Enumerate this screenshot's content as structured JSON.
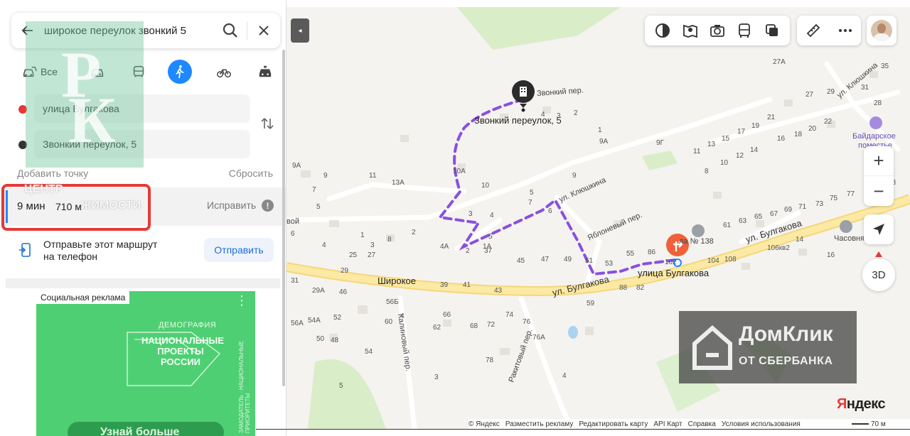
{
  "search": {
    "query": "широкое переулок звонкий 5"
  },
  "modes": {
    "all_label": "Все",
    "active": "walk"
  },
  "route_points": {
    "from": "улица Булгакова",
    "to": "Звонкий переулок, 5",
    "add_point": "Добавить точку",
    "reset": "Сбросить"
  },
  "route": {
    "time": "9 мин",
    "distance": "710 м",
    "fix": "Исправить"
  },
  "send": {
    "text_line1": "Отправьте этот маршрут",
    "text_line2": "на телефон",
    "button": "Отправить"
  },
  "ad": {
    "label": "Социальная реклама",
    "demography": "ДЕМОГРАФИЯ",
    "national": "НАЦИОНАЛЬНЫЕ ПРОЕКТЫ РОССИИ",
    "side_text": "ЗАМОДАТЕЛЬ · НАЦИОНАЛЬНЫЕ ПРИОРИТЕТЫ",
    "cta": "Узнай больше"
  },
  "watermark": {
    "rk_letters": "РК",
    "center": "ЦЕНТР",
    "estate": "ЖИМОСТИ"
  },
  "map": {
    "destination_label": "Звонкий переулок, 5",
    "origin_label": "улица Булгакова",
    "village": "Широкое",
    "school": "ла № 138",
    "pokhod_name": "Байдарское",
    "pokhod_name2": "поместье",
    "chapel": "Часовня",
    "streets": {
      "bulgakova_1": "ул. Булгакова",
      "bulgakova_2": "ул. Булгакова",
      "klyushkina": "ул. Клюшкина",
      "klyushkina_top": "ул. Клюшкина",
      "zvonkiy": "Звонкий пер.",
      "yablonevy": "Яблоневый пер.",
      "kalinovy": "Калиновый пер.",
      "rakitovy": "Ракитовый пер.",
      "voy": "вой"
    },
    "house_numbers": [
      "27А",
      "35",
      "31",
      "29",
      "27",
      "28",
      "4",
      "3",
      "2",
      "21",
      "19",
      "17",
      "15",
      "13",
      "11",
      "8",
      "10",
      "12",
      "14",
      "16",
      "18",
      "20",
      "22",
      "9Г",
      "1",
      "9А",
      "9А",
      "9",
      "7",
      "5",
      "11",
      "13А",
      "10А",
      "10",
      "9",
      "7",
      "6",
      "5",
      "4",
      "3",
      "2",
      "1",
      "8",
      "3",
      "6",
      "4",
      "25",
      "27",
      "29",
      "31",
      "29А",
      "46",
      "52",
      "54А",
      "56А",
      "50",
      "48",
      "54",
      "56Б",
      "4",
      "60",
      "62",
      "66",
      "68",
      "72",
      "74",
      "76",
      "76А",
      "78",
      "3",
      "4",
      "5",
      "1А",
      "4А",
      "2",
      "37",
      "39",
      "41",
      "43",
      "45",
      "47",
      "49",
      "51",
      "53",
      "55",
      "86",
      "88",
      "82",
      "59",
      "61",
      "63",
      "65",
      "67",
      "69",
      "71",
      "73",
      "75",
      "77",
      "96",
      "98",
      "102",
      "104",
      "108",
      "106кв2",
      "14",
      "16",
      "5"
    ],
    "domclick_title": "ДомКлик",
    "domclick_sub": "ОТ СБЕРБАНКА",
    "yandex_logo_red": "Я",
    "yandex_logo_rest": "ндекс",
    "zoom_in": "+",
    "zoom_out": "−",
    "btn_3d": "3D",
    "collapse": "◂"
  },
  "footer": {
    "items": [
      "© Яндекс",
      "Разместить рекламу",
      "Редактировать карту",
      "API Карт",
      "Справка",
      "Условия использования"
    ],
    "scale": "70 м"
  },
  "colors": {
    "accent": "#1e88ff",
    "route": "#8a4fe0",
    "highlight": "#e53935",
    "road": "#fbe9a4"
  }
}
